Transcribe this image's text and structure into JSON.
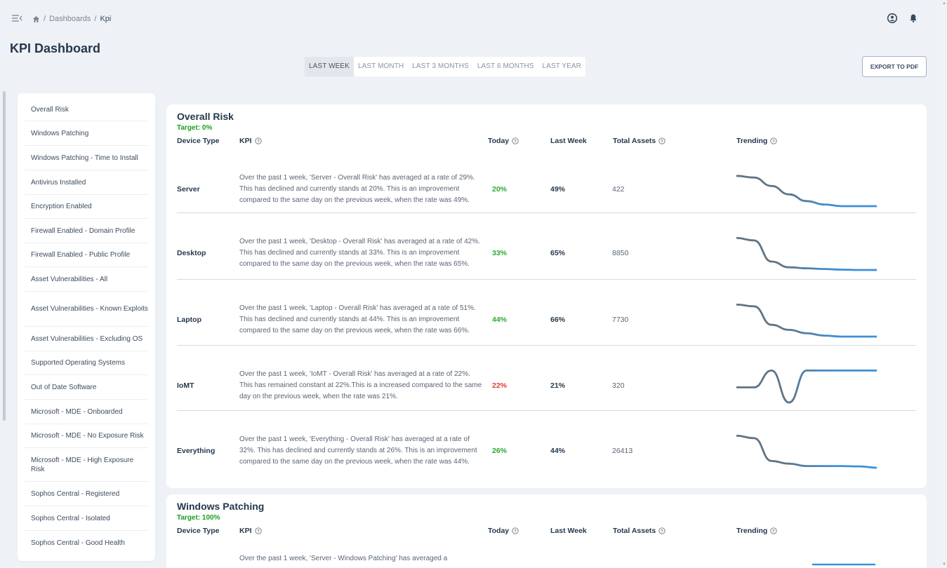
{
  "breadcrumb": {
    "home_icon": "home-icon",
    "items": [
      "/",
      "Dashboards",
      "/",
      "Kpi"
    ]
  },
  "page_title": "KPI Dashboard",
  "period_tabs": [
    "LAST WEEK",
    "LAST MONTH",
    "LAST 3 MONTHS",
    "LAST 6 MONTHS",
    "LAST YEAR"
  ],
  "active_period": "LAST WEEK",
  "export_label": "EXPORT TO PDF",
  "sidebar": {
    "items": [
      "Overall Risk",
      "Windows Patching",
      "Windows Patching - Time to Install",
      "Antivirus Installed",
      "Encryption Enabled",
      "Firewall Enabled - Domain Profile",
      "Firewall Enabled - Public Profile",
      "Asset Vulnerabilities - All",
      "Asset Vulnerabilities - Known Exploits",
      "Asset Vulnerabilities - Excluding OS",
      "Supported Operating Systems",
      "Out of Date Software",
      "Microsoft - MDE - Onboarded",
      "Microsoft - MDE - No Exposure Risk",
      "Microsoft - MDE - High Exposure Risk",
      "Sophos Central - Registered",
      "Sophos Central - Isolated",
      "Sophos Central - Good Health"
    ]
  },
  "table_headers": {
    "device": "Device Type",
    "kpi": "KPI",
    "today": "Today",
    "last_week": "Last Week",
    "total_assets": "Total Assets",
    "trending": "Trending"
  },
  "colors": {
    "improved": "#2ea82e",
    "worsened": "#e53935",
    "trend_dark": "#5f7485",
    "trend_light": "#3d8fd6"
  },
  "overall_risk": {
    "title": "Overall Risk",
    "target": "Target: 0%",
    "rows": [
      {
        "device": "Server",
        "desc": "Over the past 1 week, 'Server - Overall Risk' has averaged at a rate of 29%. This has declined and currently stands at 20%. This is an improvement compared to the same day on the previous week, when the rate was 49%.",
        "today": "20%",
        "today_status": "good",
        "last_week": "49%",
        "assets": "422",
        "trend": [
          0.9,
          0.85,
          0.6,
          0.35,
          0.15,
          0.05,
          0,
          0,
          0
        ]
      },
      {
        "device": "Desktop",
        "desc": "Over the past 1 week, 'Desktop - Overall Risk' has averaged at a rate of 42%. This has declined and currently stands at 33%. This is an improvement compared to the same day on the previous week, when the rate was 65%.",
        "today": "33%",
        "today_status": "good",
        "last_week": "65%",
        "assets": "8850",
        "trend": [
          0.95,
          0.88,
          0.25,
          0.08,
          0.05,
          0.03,
          0.01,
          0,
          0
        ]
      },
      {
        "device": "Laptop",
        "desc": "Over the past 1 week, 'Laptop - Overall Risk' has averaged at a rate of 51%. This has declined and currently stands at 44%. This is an improvement compared to the same day on the previous week, when the rate was 66%.",
        "today": "44%",
        "today_status": "good",
        "last_week": "66%",
        "assets": "7730",
        "trend": [
          0.95,
          0.9,
          0.35,
          0.2,
          0.1,
          0.03,
          0,
          0,
          0
        ]
      },
      {
        "device": "IoMT",
        "desc": "Over the past 1 week, 'IoMT - Overall Risk' has averaged at a rate of 22%. This has remained constant at 22%.This is a increased compared to the same day on the previous week, when the rate was 21%.",
        "today": "22%",
        "today_status": "bad",
        "last_week": "21%",
        "assets": "320",
        "trend": [
          0.45,
          0.45,
          0.95,
          0,
          0.95,
          0.95,
          0.95,
          0.95,
          0.95
        ]
      },
      {
        "device": "Everything",
        "desc": "Over the past 1 week, 'Everything - Overall Risk' has averaged at a rate of 32%. This has declined and currently stands at 26%. This is an improvement compared to the same day on the previous week, when the rate was 44%.",
        "today": "26%",
        "today_status": "good",
        "last_week": "44%",
        "assets": "26413",
        "trend": [
          0.95,
          0.88,
          0.2,
          0.12,
          0.05,
          0.05,
          0.05,
          0.04,
          0
        ]
      }
    ]
  },
  "windows_patching": {
    "title": "Windows Patching",
    "target": "Target: 100%",
    "partial_desc": "Over the past 1 week, 'Server - Windows Patching' has averaged a"
  }
}
